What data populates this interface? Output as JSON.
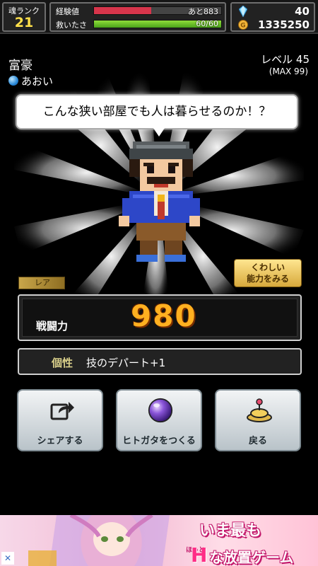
{
  "status_bar": {
    "rank_label": "魂ランク",
    "rank_value": "21",
    "exp_label": "経験値",
    "exp_text": "あと883",
    "exp_fill_fraction": 0.45,
    "hp_label": "救いたさ",
    "hp_text": "60/60",
    "hp_fill_fraction": 1.0,
    "gems": "40",
    "coins": "1335250"
  },
  "character": {
    "name": "富豪",
    "attribute": "あおい",
    "level_text": "レベル 45",
    "max_text": "(MAX 99)",
    "speech": "こんな狭い部屋でも人は暮らせるのか！？",
    "rarity": "レア",
    "detail_button_line1": "くわしい",
    "detail_button_line2": "能力をみる"
  },
  "stats": {
    "power_label": "戦闘力",
    "power_value": "980",
    "trait_label": "個性",
    "trait_value": "技のデパート+1"
  },
  "actions": {
    "share": "シェアする",
    "make": "ヒトガタをつくる",
    "back": "戻る"
  },
  "ad": {
    "headline": "いま最も",
    "small": "ほっと",
    "h_letter": "H",
    "subline": "な放置ゲーム",
    "close": "✕"
  },
  "icons": {
    "gem": "gem-icon",
    "coin": "coin-icon",
    "share": "share-icon",
    "make": "orb-icon",
    "back": "return-icon"
  },
  "colors": {
    "exp_bar": "#d7354b",
    "hp_bar": "#6cc72a",
    "power_value": "#ffb020",
    "rank_value": "#ffe04a"
  }
}
